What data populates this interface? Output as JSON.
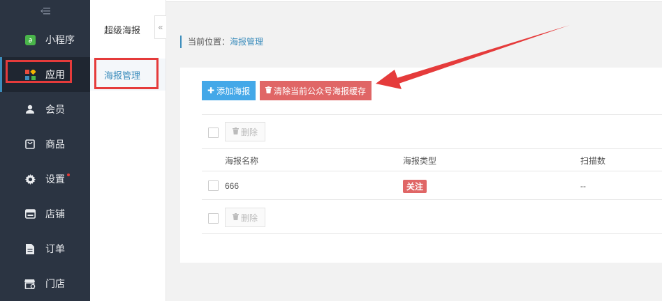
{
  "sidebar": {
    "collapse_icon": "collapse-menu-icon",
    "items": [
      {
        "label": "小程序",
        "icon": "miniprogram-icon"
      },
      {
        "label": "应用",
        "icon": "apps-icon"
      },
      {
        "label": "会员",
        "icon": "user-icon"
      },
      {
        "label": "商品",
        "icon": "bag-icon"
      },
      {
        "label": "设置",
        "icon": "gear-icon"
      },
      {
        "label": "店铺",
        "icon": "store-icon"
      },
      {
        "label": "订单",
        "icon": "document-icon"
      },
      {
        "label": "门店",
        "icon": "shop-icon"
      }
    ]
  },
  "subside": {
    "title": "超级海报",
    "active_item": "海报管理",
    "toggle_glyph": "«"
  },
  "breadcrumb": {
    "prefix": "当前位置：",
    "current": "海报管理"
  },
  "toolbar": {
    "add_label": "添加海报",
    "clear_label": "清除当前公众号海报缓存"
  },
  "table": {
    "delete_label": "删除",
    "headers": [
      "海报名称",
      "海报类型",
      "扫描数"
    ],
    "rows": [
      {
        "name": "666",
        "type": "关注",
        "scans": "--"
      }
    ]
  },
  "colors": {
    "sidebar_bg": "#2b3442",
    "accent": "#3c8dbc",
    "blue_button": "#44a8e8",
    "red_button": "#e06666",
    "annotation_red": "#e53b3b"
  }
}
